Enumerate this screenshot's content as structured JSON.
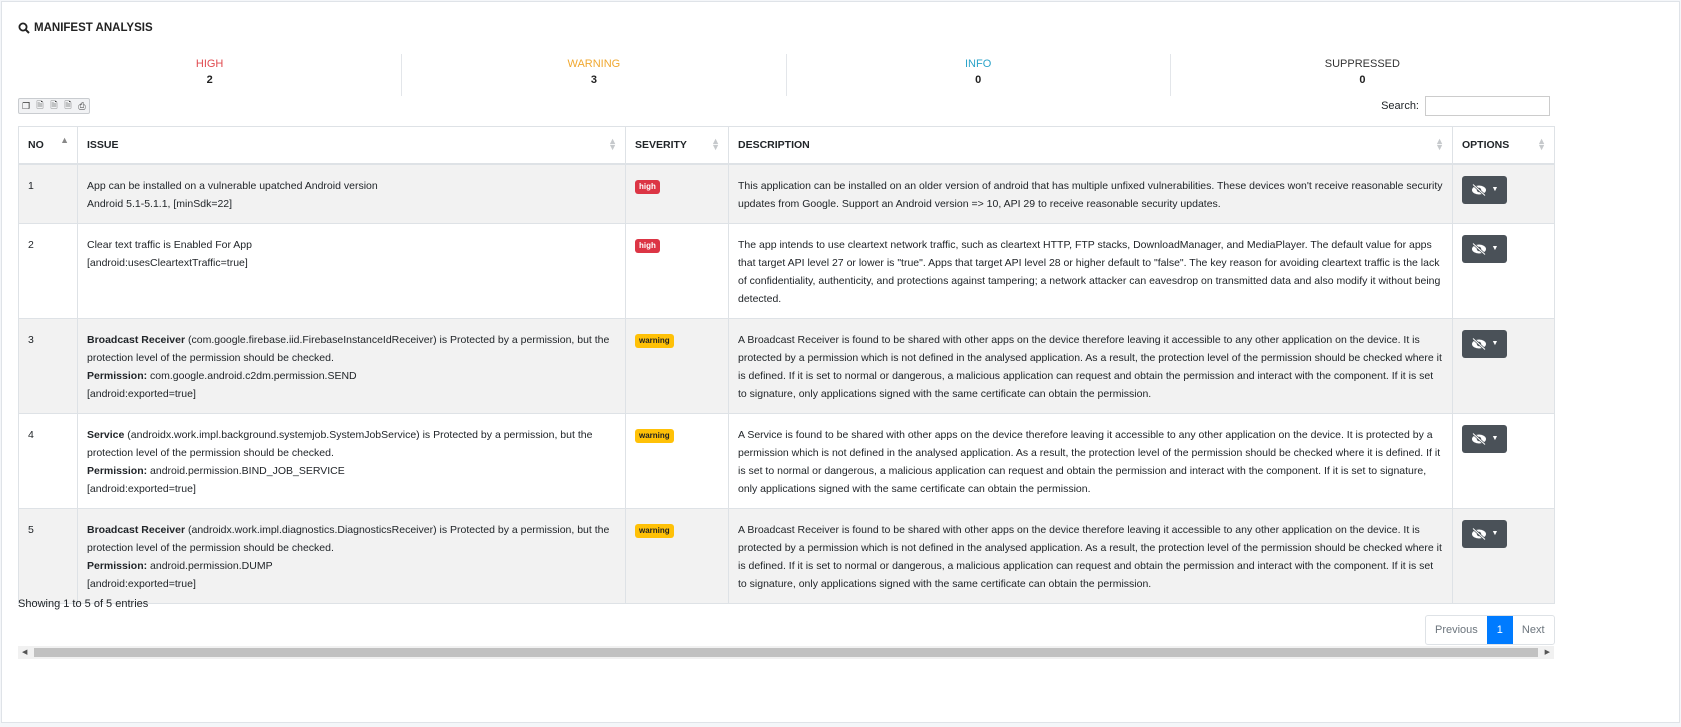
{
  "section": {
    "title": "MANIFEST ANALYSIS"
  },
  "stats": [
    {
      "label": "HIGH",
      "count": "2",
      "color": "#e04a4f"
    },
    {
      "label": "WARNING",
      "count": "3",
      "color": "#f0a830"
    },
    {
      "label": "INFO",
      "count": "0",
      "color": "#2aa3c9"
    },
    {
      "label": "SUPPRESSED",
      "count": "0",
      "color": "#333333"
    }
  ],
  "search": {
    "label": "Search:",
    "value": ""
  },
  "table": {
    "headers": {
      "no": "NO",
      "issue": "ISSUE",
      "severity": "SEVERITY",
      "description": "DESCRIPTION",
      "options": "OPTIONS"
    },
    "rows": [
      {
        "no": "1",
        "issue_bold": "",
        "issue_text": "App can be installed on a vulnerable upatched Android version",
        "issue_line2": "Android 5.1-5.1.1, [minSdk=22]",
        "permission_label": "",
        "permission_value": "",
        "issue_line4": "",
        "severity": "high",
        "description": "This application can be installed on an older version of android that has multiple unfixed vulnerabilities. These devices won't receive reasonable security updates from Google. Support an Android version => 10, API 29 to receive reasonable security updates."
      },
      {
        "no": "2",
        "issue_bold": "",
        "issue_text": "Clear text traffic is Enabled For App",
        "issue_line2": "[android:usesCleartextTraffic=true]",
        "permission_label": "",
        "permission_value": "",
        "issue_line4": "",
        "severity": "high",
        "description": "The app intends to use cleartext network traffic, such as cleartext HTTP, FTP stacks, DownloadManager, and MediaPlayer. The default value for apps that target API level 27 or lower is \"true\". Apps that target API level 28 or higher default to \"false\". The key reason for avoiding cleartext traffic is the lack of confidentiality, authenticity, and protections against tampering; a network attacker can eavesdrop on transmitted data and also modify it without being detected."
      },
      {
        "no": "3",
        "issue_bold": "Broadcast Receiver",
        "issue_text": " (com.google.firebase.iid.FirebaseInstanceIdReceiver) is Protected by a permission, but the protection level of the permission should be checked.",
        "issue_line2": "",
        "permission_label": "Permission:",
        "permission_value": " com.google.android.c2dm.permission.SEND",
        "issue_line4": "[android:exported=true]",
        "severity": "warning",
        "description": "A Broadcast Receiver is found to be shared with other apps on the device therefore leaving it accessible to any other application on the device. It is protected by a permission which is not defined in the analysed application. As a result, the protection level of the permission should be checked where it is defined. If it is set to normal or dangerous, a malicious application can request and obtain the permission and interact with the component. If it is set to signature, only applications signed with the same certificate can obtain the permission."
      },
      {
        "no": "4",
        "issue_bold": "Service",
        "issue_text": " (androidx.work.impl.background.systemjob.SystemJobService) is Protected by a permission, but the protection level of the permission should be checked.",
        "issue_line2": "",
        "permission_label": "Permission:",
        "permission_value": " android.permission.BIND_JOB_SERVICE",
        "issue_line4": "[android:exported=true]",
        "severity": "warning",
        "description": "A Service is found to be shared with other apps on the device therefore leaving it accessible to any other application on the device. It is protected by a permission which is not defined in the analysed application. As a result, the protection level of the permission should be checked where it is defined. If it is set to normal or dangerous, a malicious application can request and obtain the permission and interact with the component. If it is set to signature, only applications signed with the same certificate can obtain the permission."
      },
      {
        "no": "5",
        "issue_bold": "Broadcast Receiver",
        "issue_text": " (androidx.work.impl.diagnostics.DiagnosticsReceiver) is Protected by a permission, but the protection level of the permission should be checked.",
        "issue_line2": "",
        "permission_label": "Permission:",
        "permission_value": " android.permission.DUMP",
        "issue_line4": "[android:exported=true]",
        "severity": "warning",
        "description": "A Broadcast Receiver is found to be shared with other apps on the device therefore leaving it accessible to any other application on the device. It is protected by a permission which is not defined in the analysed application. As a result, the protection level of the permission should be checked where it is defined. If it is set to normal or dangerous, a malicious application can request and obtain the permission and interact with the component. If it is set to signature, only applications signed with the same certificate can obtain the permission."
      }
    ]
  },
  "footer": {
    "info": "Showing 1 to 5 of 5 entries",
    "previous": "Previous",
    "page": "1",
    "next": "Next"
  },
  "icons": {
    "title_icon": "search-icon",
    "export_icons": [
      "copy-icon",
      "csv-icon",
      "excel-icon",
      "pdf-icon",
      "print-icon"
    ],
    "option_icon": "eye-slash-icon"
  }
}
